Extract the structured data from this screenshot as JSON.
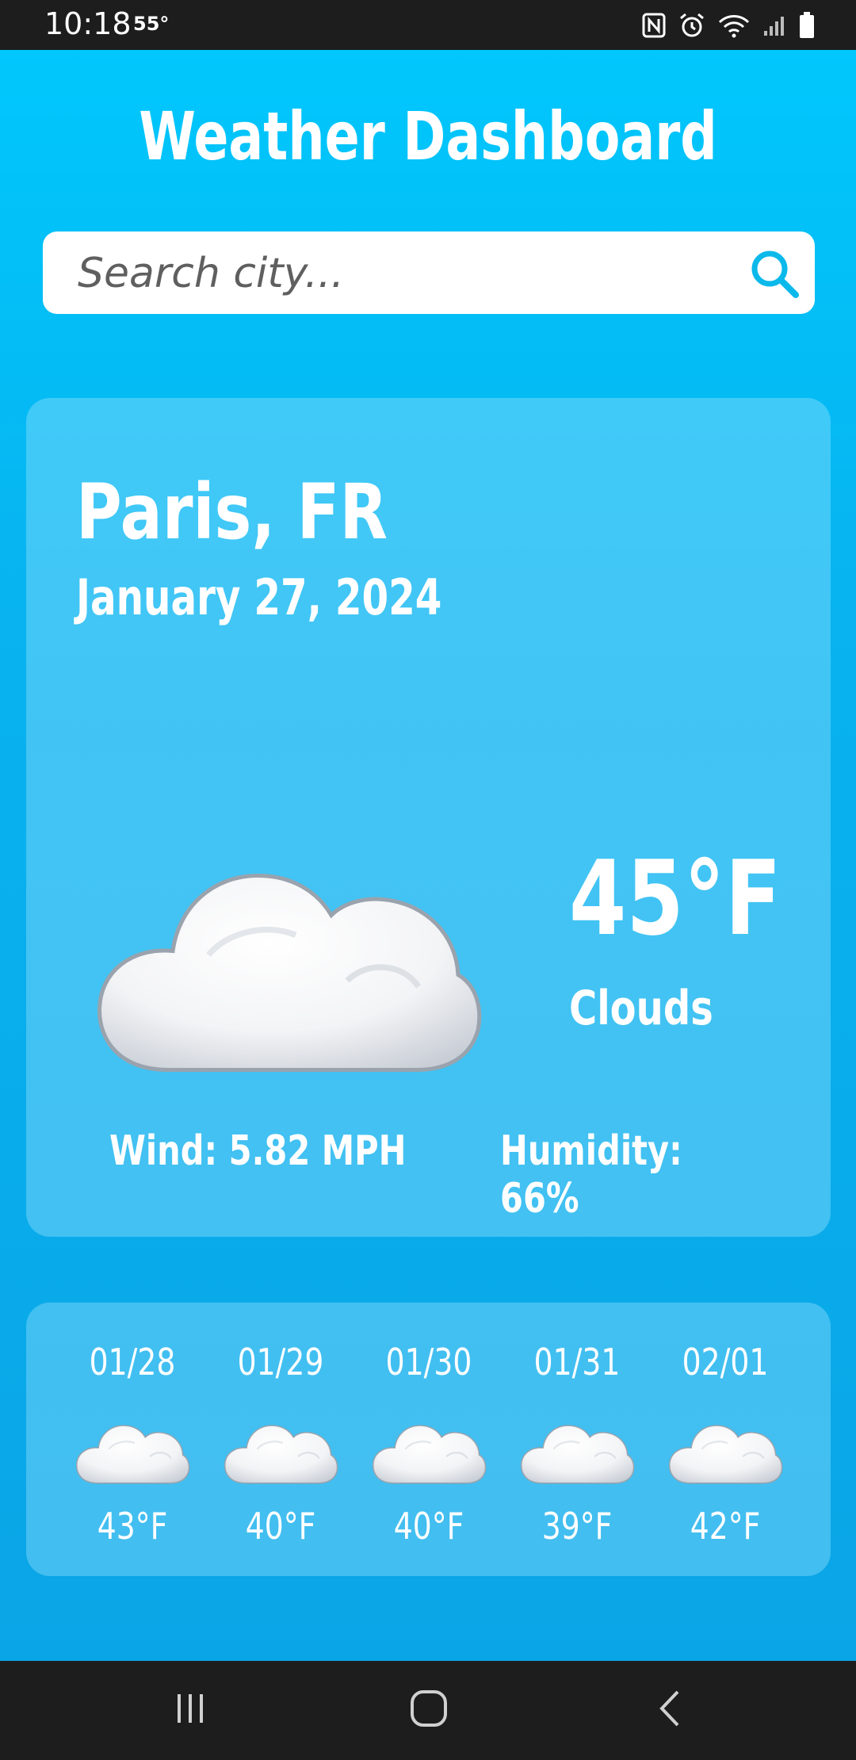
{
  "status_bar": {
    "time": "10:18",
    "temperature": "55°",
    "icons": [
      "nfc-icon",
      "alarm-icon",
      "wifi-icon",
      "signal-icon",
      "battery-icon"
    ]
  },
  "app": {
    "title": "Weather Dashboard",
    "search": {
      "placeholder": "Search city..."
    },
    "current": {
      "city": "Paris, FR",
      "date": "January 27, 2024",
      "icon": "cloud-icon",
      "temperature": "45°F",
      "condition": "Clouds",
      "wind": "Wind: 5.82 MPH",
      "humidity": "Humidity: 66%"
    },
    "forecast": [
      {
        "date": "01/28",
        "icon": "cloud-icon",
        "temp": "43°F"
      },
      {
        "date": "01/29",
        "icon": "cloud-icon",
        "temp": "40°F"
      },
      {
        "date": "01/30",
        "icon": "cloud-icon",
        "temp": "40°F"
      },
      {
        "date": "01/31",
        "icon": "cloud-icon",
        "temp": "39°F"
      },
      {
        "date": "02/01",
        "icon": "cloud-icon",
        "temp": "42°F"
      }
    ]
  },
  "nav_bar": {
    "buttons": [
      "recent-apps-icon",
      "home-icon",
      "back-icon"
    ]
  },
  "colors": {
    "accent": "#0bb9ea",
    "background_top": "#00c7fd",
    "background_bottom": "#0aa5e6"
  }
}
